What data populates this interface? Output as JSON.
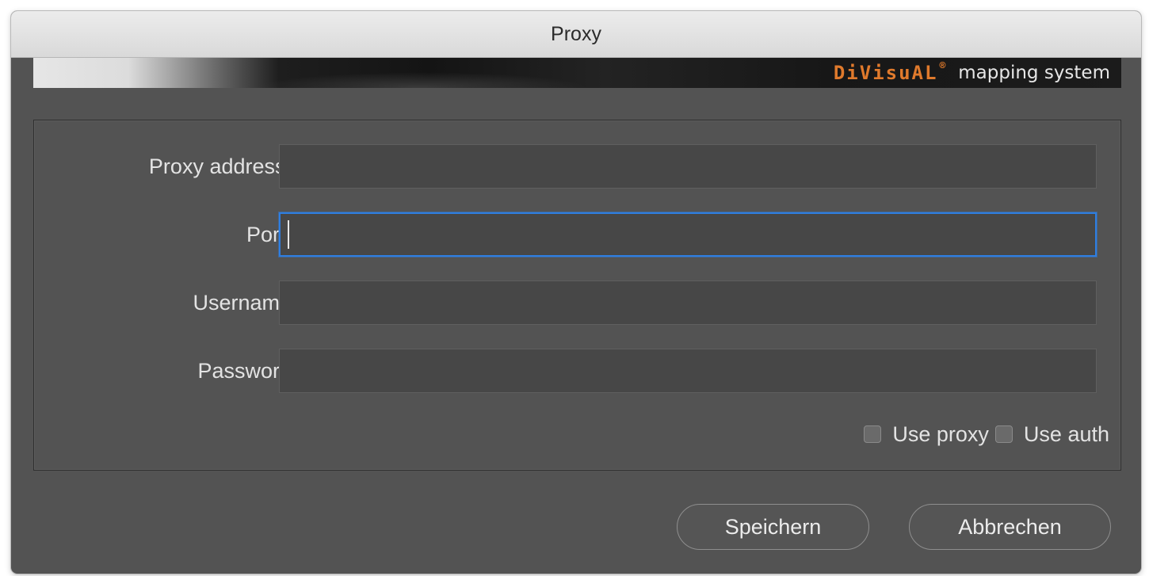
{
  "window": {
    "title": "Proxy"
  },
  "banner": {
    "brand": "DiVisuAL",
    "registered": "®",
    "subtitle": "mapping system"
  },
  "form": {
    "proxy_address": {
      "label": "Proxy address:",
      "value": ""
    },
    "port": {
      "label": "Port:",
      "value": ""
    },
    "username": {
      "label": "Username",
      "value": ""
    },
    "password": {
      "label": "Password",
      "value": ""
    }
  },
  "options": {
    "use_proxy": {
      "label": "Use proxy",
      "checked": false
    },
    "use_auth": {
      "label": "Use auth",
      "checked": false
    }
  },
  "buttons": {
    "save": "Speichern",
    "cancel": "Abbrechen"
  },
  "colors": {
    "background": "#535353",
    "accent_focus": "#2f7ee0",
    "brand_orange": "#e07a2c"
  }
}
